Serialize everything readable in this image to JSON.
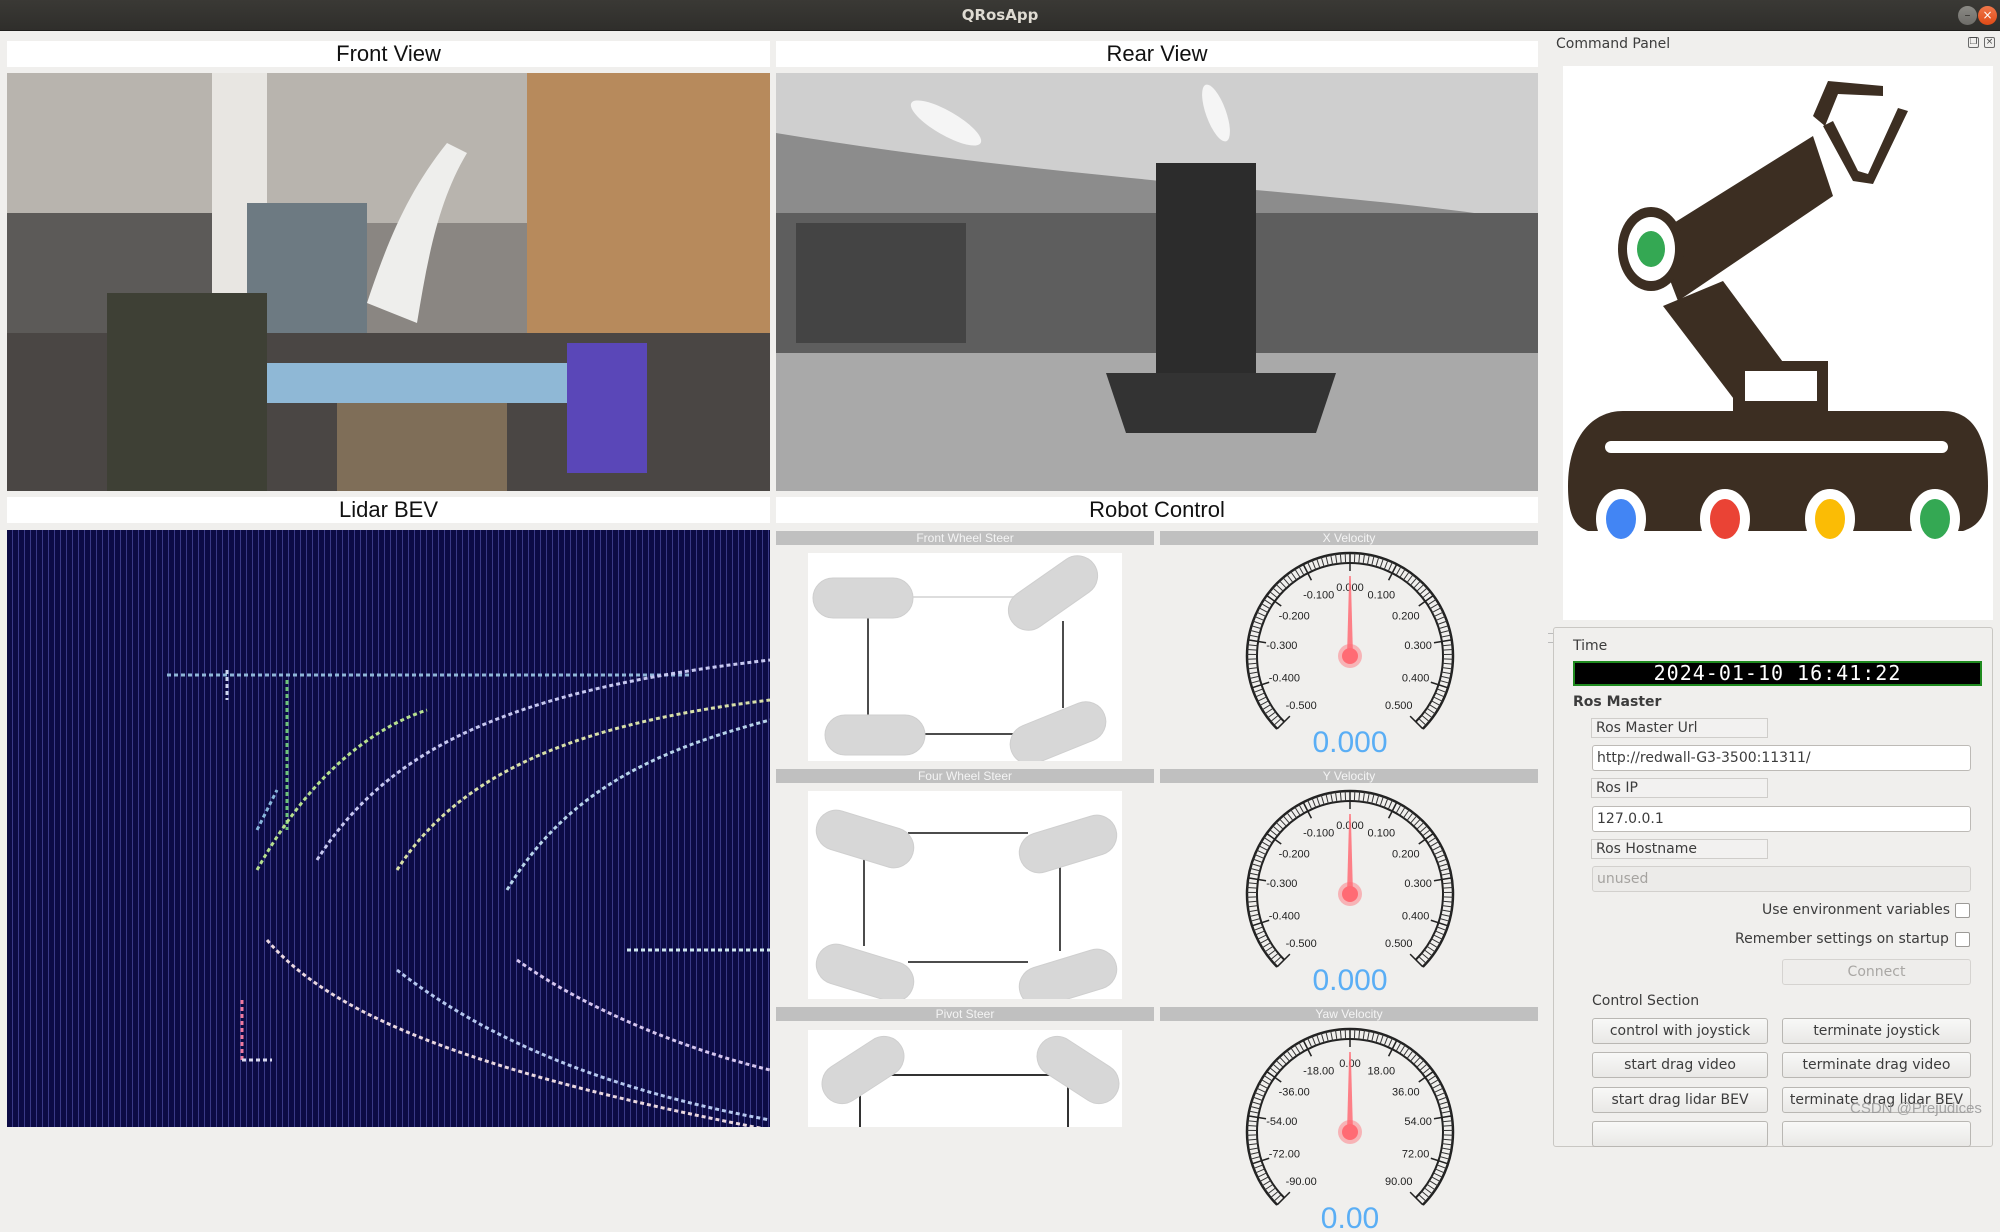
{
  "window": {
    "title": "QRosApp"
  },
  "views": {
    "front": {
      "title": "Front View"
    },
    "rear": {
      "title": "Rear View"
    },
    "lidar": {
      "title": "Lidar BEV"
    },
    "control": {
      "title": "Robot Control"
    }
  },
  "robot_control": {
    "steer_panels": [
      {
        "title": "Front Wheel Steer"
      },
      {
        "title": "Four Wheel Steer"
      },
      {
        "title": "Pivot Steer"
      }
    ],
    "gauges": [
      {
        "title": "X Velocity",
        "value": 0.0,
        "value_text": "0.000",
        "ticks": [
          "-0.500",
          "-0.400",
          "-0.300",
          "-0.200",
          "-0.100",
          "0.000",
          "0.100",
          "0.200",
          "0.300",
          "0.400",
          "0.500"
        ],
        "min": -0.5,
        "max": 0.5
      },
      {
        "title": "Y Velocity",
        "value": 0.0,
        "value_text": "0.000",
        "ticks": [
          "-0.500",
          "-0.400",
          "-0.300",
          "-0.200",
          "-0.100",
          "0.000",
          "0.100",
          "0.200",
          "0.300",
          "0.400",
          "0.500"
        ],
        "min": -0.5,
        "max": 0.5
      },
      {
        "title": "Yaw Velocity",
        "value": 0.0,
        "value_text": "0.00",
        "ticks": [
          "-90.00",
          "-72.00",
          "-54.00",
          "-36.00",
          "-18.00",
          "0.00",
          "18.00",
          "36.00",
          "54.00",
          "72.00",
          "90.00"
        ],
        "min": -90,
        "max": 90
      }
    ],
    "colors": {
      "needle": "#ff6b74",
      "value_text": "#5aaef5",
      "header_bg": "#c0c0c0"
    }
  },
  "command_panel": {
    "title": "Command Panel",
    "time_label": "Time",
    "time_value": "2024-01-10 16:41:22",
    "ros_master_heading": "Ros Master",
    "ros_master_url_label": "Ros Master Url",
    "ros_master_url_value": "http://redwall-G3-3500:11311/",
    "ros_ip_label": "Ros IP",
    "ros_ip_value": "127.0.0.1",
    "ros_hostname_label": "Ros Hostname",
    "ros_hostname_value": "unused",
    "use_env_label": "Use environment variables",
    "use_env_checked": false,
    "remember_label": "Remember settings on startup",
    "remember_checked": false,
    "connect_label": "Connect",
    "control_section_label": "Control Section",
    "buttons": [
      "control with joystick",
      "terminate joystick",
      "start drag video",
      "terminate drag video",
      "start drag lidar BEV",
      "terminate drag lidar BEV"
    ]
  },
  "watermark": "CSDN @Prejudices"
}
